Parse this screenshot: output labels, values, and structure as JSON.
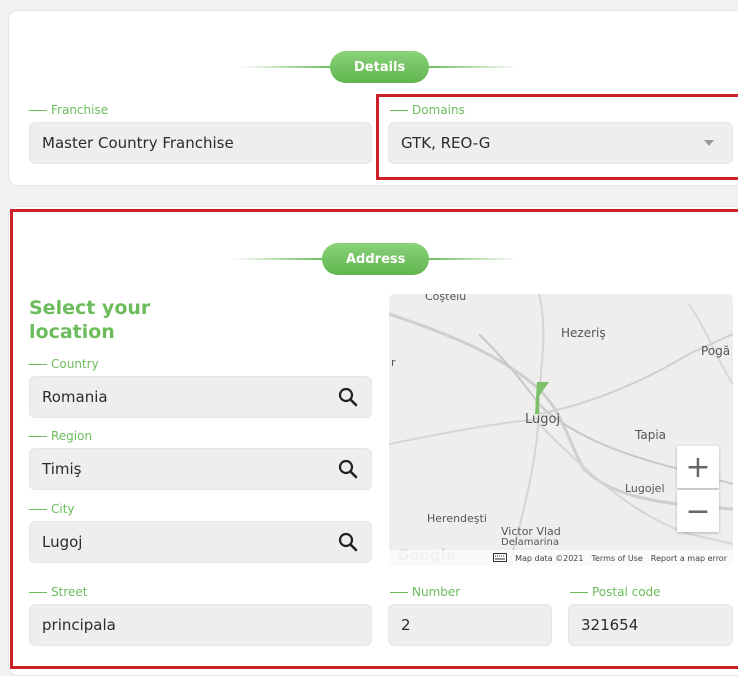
{
  "details": {
    "section_title": "Details",
    "franchise": {
      "label": "Franchise",
      "value": "Master Country Franchise"
    },
    "domains": {
      "label": "Domains",
      "value": "GTK, REO-G"
    }
  },
  "address": {
    "section_title": "Address",
    "select_location": "Select your location",
    "country": {
      "label": "Country",
      "value": "Romania"
    },
    "region": {
      "label": "Region",
      "value": "Timiş"
    },
    "city": {
      "label": "City",
      "value": "Lugoj"
    },
    "street": {
      "label": "Street",
      "value": "principala"
    },
    "number": {
      "label": "Number",
      "value": "2"
    },
    "postal_code": {
      "label": "Postal code",
      "value": "321654"
    }
  },
  "map": {
    "towns": {
      "top": "Coştelu",
      "hezeris": "Hezeriş",
      "poga": "Pogă",
      "lugoj": "Lugoj",
      "tapia": "Tapia",
      "lugojel": "Lugojel",
      "herendesti": "Herendeşti",
      "victor": "Victor Vlad",
      "delamarina": "Delamarina",
      "r": "r"
    },
    "zoom_in": "+",
    "zoom_out": "−",
    "logo": "Google",
    "map_data": "Map data ©2021",
    "terms": "Terms of Use",
    "report": "Report a map error"
  },
  "colors": {
    "accent": "#6cbc5c",
    "highlight": "#cc1f28"
  }
}
